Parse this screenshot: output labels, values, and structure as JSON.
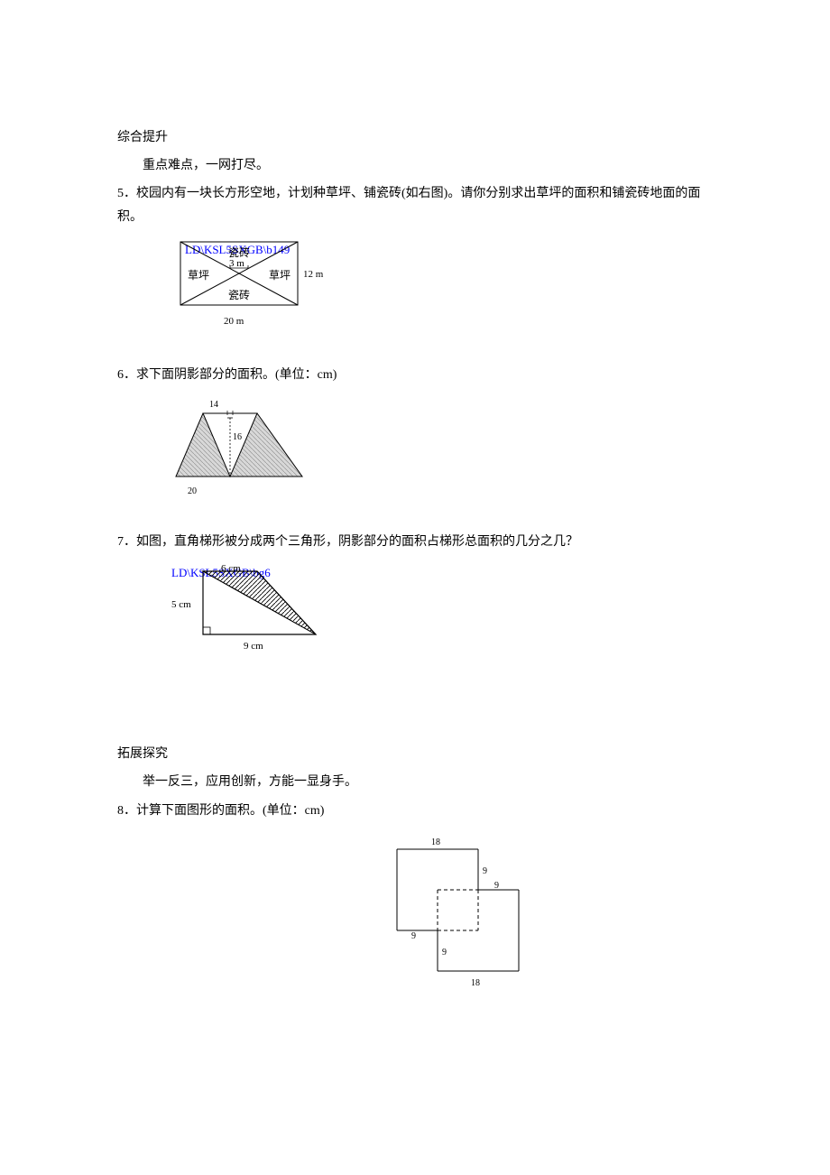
{
  "sections": {
    "s1_title": "综合提升",
    "s1_sub": "重点难点，一网打尽。",
    "s2_title": "拓展探究",
    "s2_sub": "举一反三，应用创新，方能一显身手。"
  },
  "problems": {
    "p5": "5．校园内有一块长方形空地，计划种草坪、铺瓷砖(如右图)。请你分别求出草坪的面积和铺瓷砖地面的面积。",
    "p6": "6．求下面阴影部分的面积。(单位：cm)",
    "p7": "7．如图，直角梯形被分成两个三角形，阴影部分的面积占梯形总面积的几分之几？",
    "p8": "8．计算下面图形的面积。(单位：cm)"
  },
  "fig5": {
    "watermark": "LD\\KSL5SXGB\\b149",
    "tile_top": "瓷砖",
    "tile_bottom": "瓷砖",
    "lawn_left": "草坪",
    "lawn_right": "草坪",
    "mid_dim": "3 m",
    "right_dim": "12 m",
    "bottom_dim": "20 m"
  },
  "fig6": {
    "top_dim": "14",
    "mid_dim": "16",
    "bottom_dim": "20"
  },
  "fig7": {
    "watermark": "LD\\KSL5SXGB\\bg6",
    "top_dim": "6 cm",
    "left_dim": "5 cm",
    "bottom_dim": "9 cm"
  },
  "fig8": {
    "d18a": "18",
    "d9a": "9",
    "d9b": "9",
    "d9c": "9",
    "d9d": "9",
    "d18b": "18"
  }
}
